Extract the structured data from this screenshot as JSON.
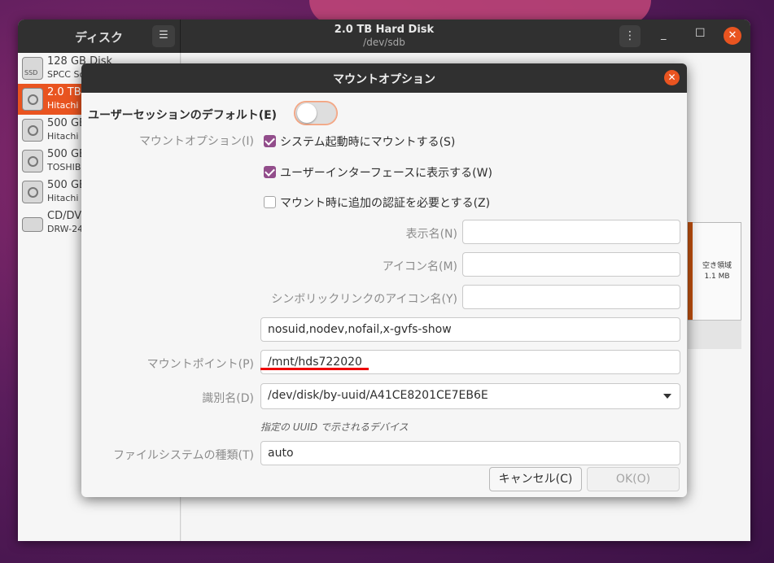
{
  "app": {
    "sidebar_title": "ディスク",
    "menu_icon": "hamburger-icon",
    "window_title": "2.0 TB Hard Disk",
    "window_subtitle": "/dev/sdb"
  },
  "disks": [
    {
      "name": "128 GB Disk",
      "sub": "SPCC So",
      "icon": "ssd-icon",
      "icon_label": "SSD"
    },
    {
      "name": "2.0 TB",
      "sub": "Hitachi",
      "icon": "hard-disk-icon",
      "selected": true
    },
    {
      "name": "500 GB",
      "sub": "Hitachi",
      "icon": "hard-disk-icon"
    },
    {
      "name": "500 GB",
      "sub": "TOSHIB",
      "icon": "hard-disk-icon"
    },
    {
      "name": "500 GB",
      "sub": "Hitachi",
      "icon": "hard-disk-icon"
    },
    {
      "name": "CD/DV",
      "sub": "DRW-24",
      "icon": "optical-drive-icon"
    }
  ],
  "volume": {
    "free_label": "空き領域",
    "free_size": "1.1 MB"
  },
  "dialog": {
    "title": "マウントオプション",
    "user_session_default_label": "ユーザーセッションのデフォルト(E)",
    "user_session_default_on": false,
    "mount_options_label": "マウントオプション(I)",
    "mount_at_startup_label": "システム起動時にマウントする(S)",
    "mount_at_startup_checked": true,
    "show_in_ui_label": "ユーザーインターフェースに表示する(W)",
    "show_in_ui_checked": true,
    "require_auth_label": "マウント時に追加の認証を必要とする(Z)",
    "require_auth_checked": false,
    "display_name_label": "表示名(N)",
    "display_name_value": "",
    "icon_name_label": "アイコン名(M)",
    "icon_name_value": "",
    "symbolic_icon_label": "シンボリックリンクのアイコン名(Y)",
    "symbolic_icon_value": "",
    "options_value": "nosuid,nodev,nofail,x-gvfs-show",
    "mount_point_label": "マウントポイント(P)",
    "mount_point_value": "/mnt/hds722020",
    "identify_as_label": "識別名(D)",
    "identify_as_value": "/dev/disk/by-uuid/A41CE8201CE7EB6E",
    "identify_hint": "指定の UUID で示されるデバイス",
    "filesystem_type_label": "ファイルシステムの種類(T)",
    "filesystem_type_value": "auto",
    "cancel_label": "キャンセル(C)",
    "ok_label": "OK(O)"
  },
  "colors": {
    "accent": "#e95420",
    "checkbox": "#924d8b",
    "annotation_underline": "#ee0000"
  }
}
